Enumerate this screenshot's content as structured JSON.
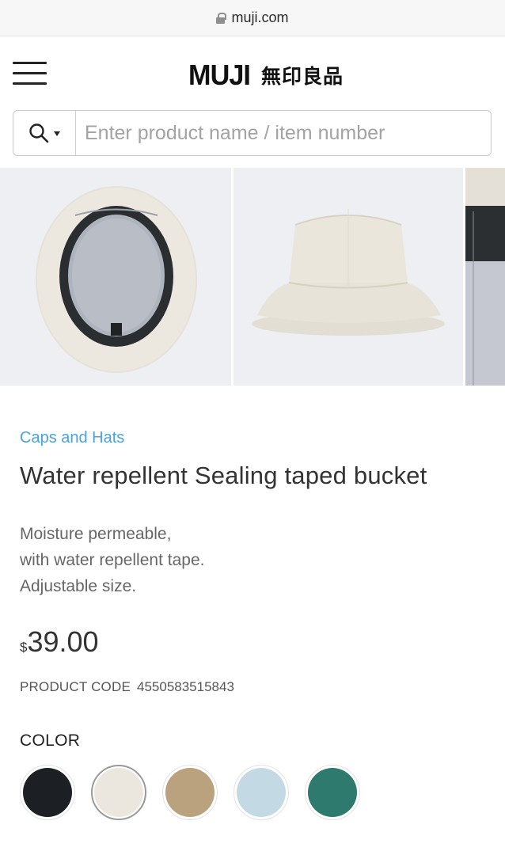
{
  "browser": {
    "url": "muji.com"
  },
  "header": {
    "logo_latin": "MUJI",
    "logo_kanji": "無印良品"
  },
  "search": {
    "placeholder": "Enter product name / item number"
  },
  "product": {
    "category": "Caps and Hats",
    "title": "Water repellent Sealing taped bucket",
    "description": [
      "Moisture permeable,",
      "with water repellent tape.",
      "Adjustable size."
    ],
    "price_currency": "$",
    "price_amount": "39.00",
    "code_label": "PRODUCT CODE",
    "code_value": "4550583515843",
    "color_label": "COLOR",
    "colors": [
      {
        "hex": "#1c2024",
        "selected": false
      },
      {
        "hex": "#ebe7df",
        "selected": true
      },
      {
        "hex": "#bba27f",
        "selected": false
      },
      {
        "hex": "#c3d9e4",
        "selected": false
      },
      {
        "hex": "#2f7a6e",
        "selected": false
      }
    ]
  },
  "icons": {
    "menu": "hamburger-icon",
    "search": "search-icon",
    "scope": "chevron-down-icon",
    "lock": "lock-icon"
  },
  "colors": {
    "link": "#4aa3df",
    "text": "#333333",
    "muted": "#666666"
  }
}
